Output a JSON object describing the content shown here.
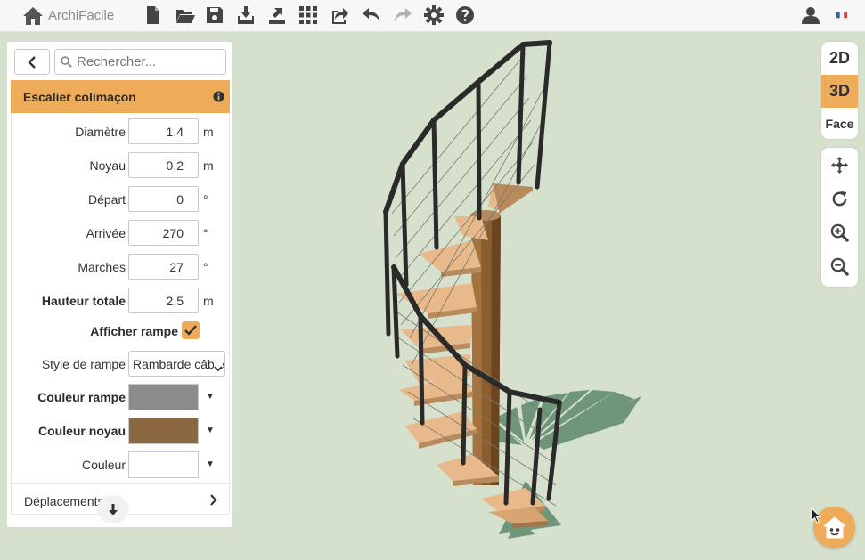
{
  "app": {
    "name": "ArchiFacile"
  },
  "toolbar": {
    "buttons": [
      {
        "icon": "new-file-icon"
      },
      {
        "icon": "open-folder-icon"
      },
      {
        "icon": "save-icon"
      },
      {
        "icon": "import-icon"
      },
      {
        "icon": "export-icon"
      },
      {
        "icon": "grid-icon"
      },
      {
        "icon": "share-icon"
      },
      {
        "icon": "undo-icon"
      },
      {
        "icon": "redo-icon"
      },
      {
        "icon": "settings-icon"
      },
      {
        "icon": "help-icon"
      }
    ],
    "right": [
      {
        "icon": "user-icon"
      },
      {
        "icon": "french-flag-icon"
      }
    ]
  },
  "panel": {
    "search_placeholder": "Rechercher...",
    "section_title": "Escalier colimaçon",
    "fields": {
      "diametre": {
        "label": "Diamètre",
        "value": "1,4",
        "unit": "m"
      },
      "noyau": {
        "label": "Noyau",
        "value": "0,2",
        "unit": "m"
      },
      "depart": {
        "label": "Départ",
        "value": "0",
        "unit": "°"
      },
      "arrivee": {
        "label": "Arrivée",
        "value": "270",
        "unit": "°"
      },
      "marches": {
        "label": "Marches",
        "value": "27",
        "unit": "°"
      },
      "hauteur": {
        "label": "Hauteur totale",
        "value": "2,5",
        "unit": "m"
      }
    },
    "afficher_rampe": {
      "label": "Afficher rampe",
      "checked": true
    },
    "style_rampe": {
      "label": "Style de rampe",
      "selected": "Rambarde câbles"
    },
    "couleur_rampe": {
      "label": "Couleur rampe",
      "color": "#8c8c8c"
    },
    "couleur_noyau": {
      "label": "Couleur noyau",
      "color": "#8b6840"
    },
    "couleur": {
      "label": "Couleur",
      "color": "#ffffff"
    },
    "footer_label": "Déplacements"
  },
  "view_modes": [
    {
      "label": "2D",
      "active": false
    },
    {
      "label": "3D",
      "active": true
    },
    {
      "label": "Face",
      "active": false
    }
  ],
  "navigation": [
    {
      "icon": "move-icon"
    },
    {
      "icon": "rotate-icon"
    },
    {
      "icon": "zoom-in-icon"
    },
    {
      "icon": "zoom-out-icon"
    }
  ],
  "colors": {
    "accent": "#eeab5a",
    "scene_background": "#d5e1cd",
    "stair_wood": "#e8b98a",
    "post": "#8b5e2e",
    "railing": "#2a2a28",
    "shadow": "#5e8a6c"
  }
}
